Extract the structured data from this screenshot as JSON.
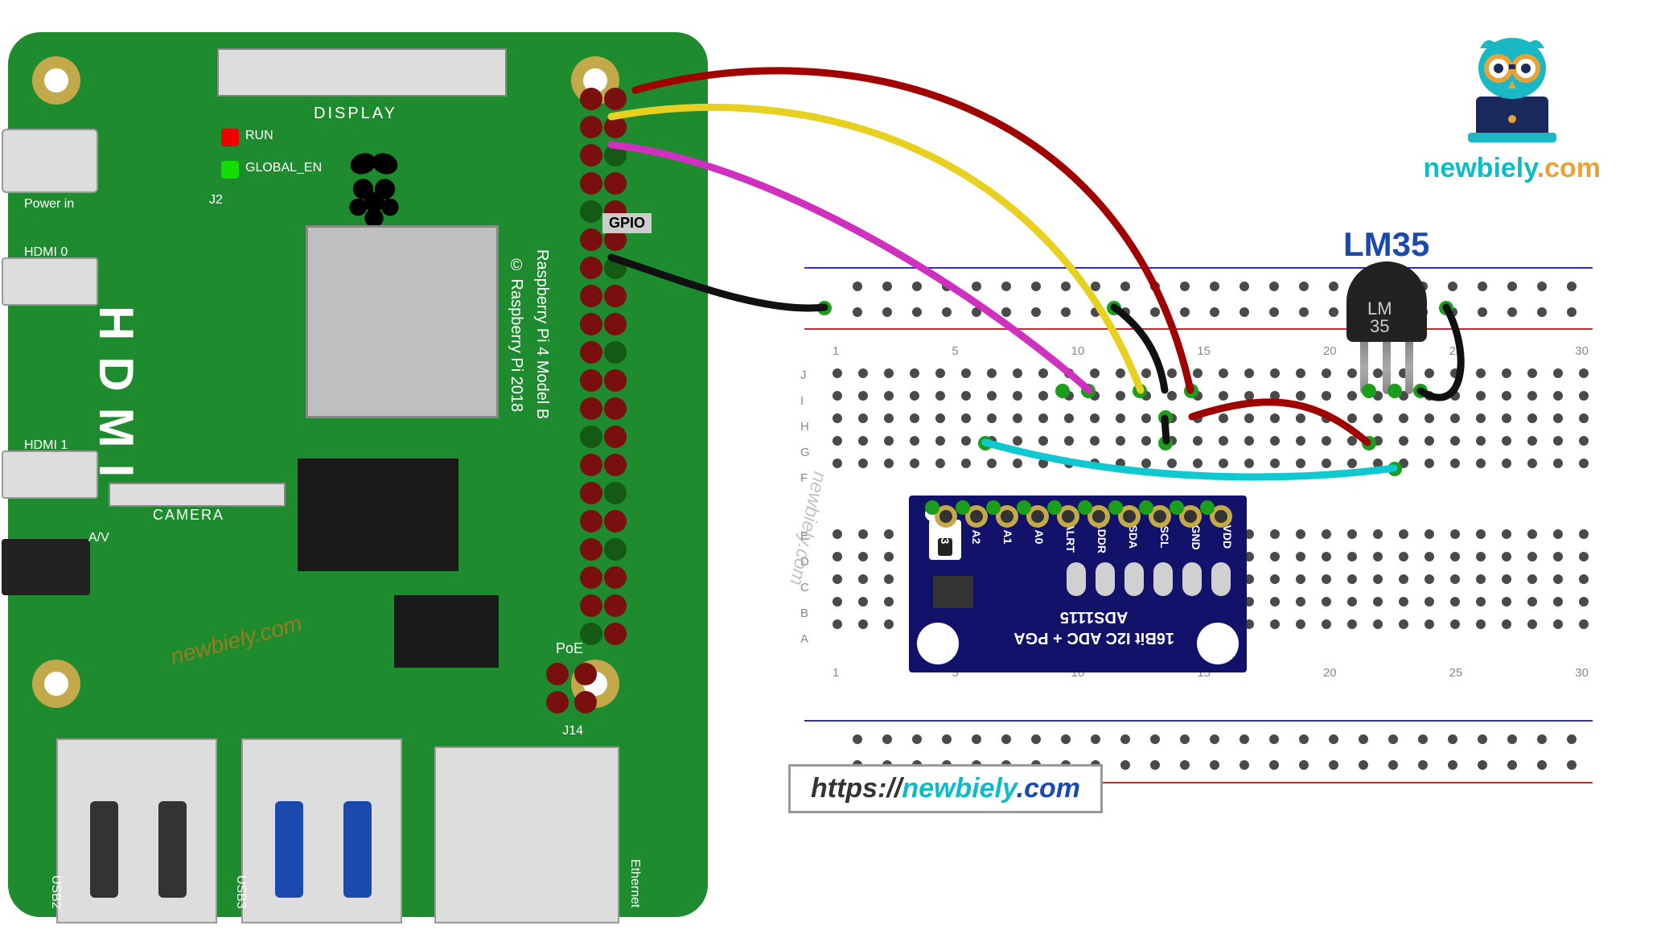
{
  "rpi": {
    "display_label": "DISPLAY",
    "run": "RUN",
    "global_en": "GLOBAL_EN",
    "j2": "J2",
    "gpio_label": "GPIO",
    "model_text": "Raspberry Pi 4 Model B\n© Raspberry Pi 2018",
    "hdmi_label": "HDMI",
    "power_in": "Power in",
    "hdmi0": "HDMI 0",
    "hdmi1": "HDMI 1",
    "camera": "CAMERA",
    "av": "A/V",
    "poe": "PoE",
    "j14": "J14",
    "usb2": "USB2",
    "usb3": "USB3",
    "ethernet": "Ethernet",
    "watermark": "newbiely.com"
  },
  "ads": {
    "main_line1": "16Bit I2C ADC + PGA",
    "main_line2": "ADS1115",
    "pin_labels": [
      "VDD",
      "GND",
      "SCL",
      "SDA",
      "ADDR",
      "ALRT",
      "A0",
      "A1",
      "A2",
      "A3"
    ]
  },
  "lm35": {
    "label": "LM35",
    "body_text": "LM\n35"
  },
  "breadboard": {
    "row_labels": [
      "A",
      "B",
      "C",
      "D",
      "E",
      "F",
      "G",
      "H",
      "I",
      "J"
    ],
    "col_labels": [
      "1",
      "5",
      "10",
      "15",
      "20",
      "25",
      "30"
    ]
  },
  "url": {
    "prefix": "https://",
    "mid": "newbiely",
    "suffix": ".com"
  },
  "logo": {
    "part1": "newbiely",
    "part2": ".com"
  },
  "watermark_bb": "newbiely.com",
  "wires": {
    "red": {
      "from": "GPIO 5V pin 2",
      "to": "ADS VDD"
    },
    "black_top": {
      "from": "GPIO GND pin 9",
      "to": "ADS GND rail / breadboard GND"
    },
    "yellow": {
      "from": "GPIO SCL pin 5",
      "to": "ADS SCL"
    },
    "magenta": {
      "from": "GPIO SDA pin 3",
      "to": "ADS SDA"
    },
    "cyan": {
      "from": "ADS A0",
      "to": "LM35 Vout"
    },
    "red_short": {
      "from": "ADS VDD",
      "to": "LM35 VCC"
    },
    "black_lm35": {
      "from": "LM35 GND",
      "to": "breadboard GND rail"
    },
    "black_rail": {
      "from": "breadboard column",
      "to": "GND rail"
    }
  }
}
